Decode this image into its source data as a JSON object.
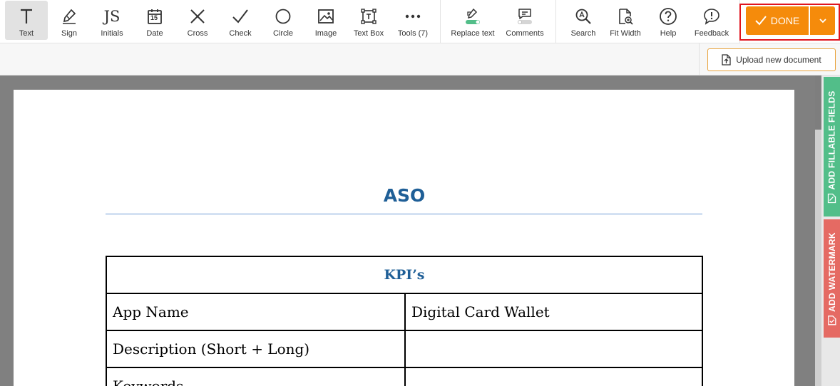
{
  "toolbar": {
    "tools": [
      {
        "label": "Text",
        "icon": "text-icon"
      },
      {
        "label": "Sign",
        "icon": "sign-pen-icon"
      },
      {
        "label": "Initials",
        "icon": "initials-icon"
      },
      {
        "label": "Date",
        "icon": "calendar-icon"
      },
      {
        "label": "Cross",
        "icon": "cross-icon"
      },
      {
        "label": "Check",
        "icon": "check-icon"
      },
      {
        "label": "Circle",
        "icon": "circle-icon"
      },
      {
        "label": "Image",
        "icon": "image-icon"
      },
      {
        "label": "Text Box",
        "icon": "text-box-icon"
      },
      {
        "label": "Tools (7)",
        "icon": "more-dots-icon"
      },
      {
        "label": "Replace text",
        "icon": "replace-text-icon"
      },
      {
        "label": "Comments",
        "icon": "comments-icon"
      },
      {
        "label": "Search",
        "icon": "search-icon"
      },
      {
        "label": "Fit Width",
        "icon": "fit-width-icon"
      },
      {
        "label": "Help",
        "icon": "help-icon"
      },
      {
        "label": "Feedback",
        "icon": "feedback-icon"
      }
    ],
    "initials_glyph": "JS",
    "date_glyph": "15",
    "done_label": "DONE"
  },
  "subbar": {
    "upload_label": "Upload new document"
  },
  "document": {
    "title": "ASO",
    "table": {
      "header": "KPI’s",
      "rows": [
        [
          "App Name",
          "Digital Card Wallet"
        ],
        [
          "Description (Short + Long)",
          ""
        ],
        [
          "Keywords",
          ""
        ]
      ]
    }
  },
  "side_tabs": {
    "fillable": "ADD FILLABLE FIELDS",
    "watermark": "ADD WATERMARK"
  },
  "colors": {
    "accent": "#f58b0b",
    "done_outline": "#e0141e",
    "fillable_tab": "#52be89",
    "watermark_tab": "#e56a63",
    "doc_heading": "#1f5f97"
  }
}
